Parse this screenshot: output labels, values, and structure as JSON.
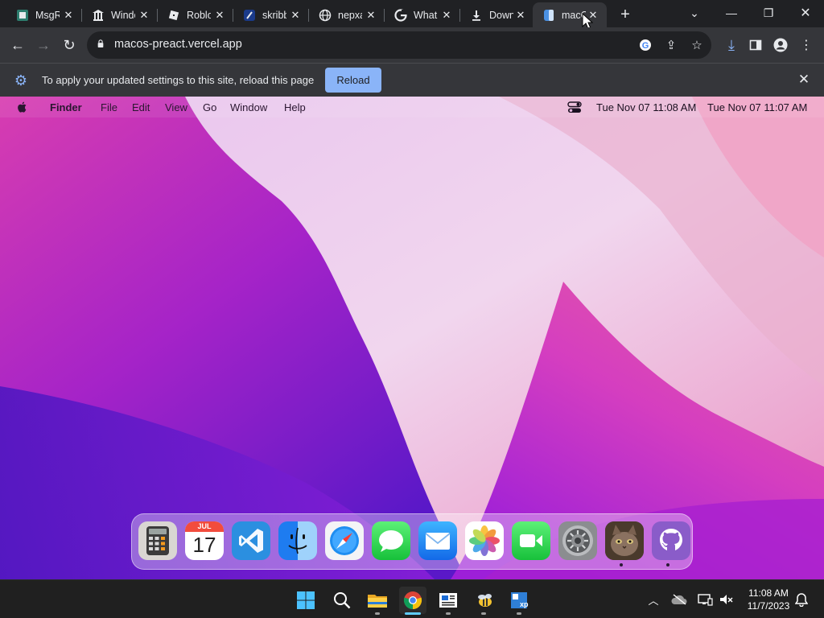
{
  "browser": {
    "tabs": [
      {
        "title": "MsgR",
        "icon": "msgroom-icon"
      },
      {
        "title": "Windo",
        "icon": "museum-icon"
      },
      {
        "title": "Roblo",
        "icon": "roblox-icon"
      },
      {
        "title": "skribb",
        "icon": "skribbl-icon"
      },
      {
        "title": "nepxa",
        "icon": "globe-icon"
      },
      {
        "title": "What",
        "icon": "google-icon"
      },
      {
        "title": "Down",
        "icon": "download-icon"
      },
      {
        "title": "macO",
        "icon": "finder-icon",
        "active": true
      }
    ],
    "address": "macos-preact.vercel.app",
    "infobar": {
      "message": "To apply your updated settings to this site, reload this page",
      "button": "Reload"
    }
  },
  "macos": {
    "menubar": {
      "app": "Finder",
      "menus": [
        "File",
        "Edit",
        "View",
        "Go",
        "Window",
        "Help"
      ],
      "clock_1": "Tue Nov 07  11:08 AM",
      "clock_2": "Tue Nov 07  11:07 AM"
    },
    "dock": {
      "calendar_month": "JUL",
      "calendar_day": "17",
      "items": [
        "calculator-icon",
        "calendar-icon",
        "vscode-icon",
        "finder-icon",
        "safari-icon",
        "messages-icon",
        "mail-icon",
        "photos-icon",
        "facetime-icon",
        "system-preferences-icon",
        "cat-avatar-icon",
        "github-icon"
      ]
    }
  },
  "windows": {
    "clock_time": "11:08 AM",
    "clock_date": "11/7/2023"
  },
  "colors": {
    "chrome_dark": "#202124",
    "chrome_toolbar": "#35363a",
    "accent_blue": "#8ab4f8",
    "taskbar": "#202020"
  }
}
